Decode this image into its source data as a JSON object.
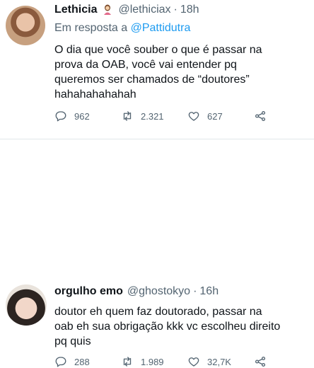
{
  "tweets": [
    {
      "display_name": "Lethicia",
      "badge_icon": "woman-emoji-icon",
      "handle": "@lethiciax",
      "separator": "·",
      "time": "18h",
      "reply_prefix": "Em resposta a",
      "reply_to": "@Pattidutra",
      "text": "O dia que você souber o que é passar na\nprova da OAB, você vai entender pq\nqueremos ser chamados de “doutores”\nhahahahahahah",
      "replies": "962",
      "retweets": "2.321",
      "likes": "627"
    },
    {
      "display_name": "orgulho emo",
      "handle": "@ghostokyo",
      "separator": "·",
      "time": "16h",
      "text": "doutor eh quem faz doutorado, passar na\noab eh sua obrigação kkk vc escolheu direito\npq quis",
      "replies": "288",
      "retweets": "1.989",
      "likes": "32,7K"
    }
  ],
  "colors": {
    "text": "#0f1419",
    "secondary": "#536471",
    "link": "#1d9bf0",
    "divider": "#e1e6ea"
  }
}
